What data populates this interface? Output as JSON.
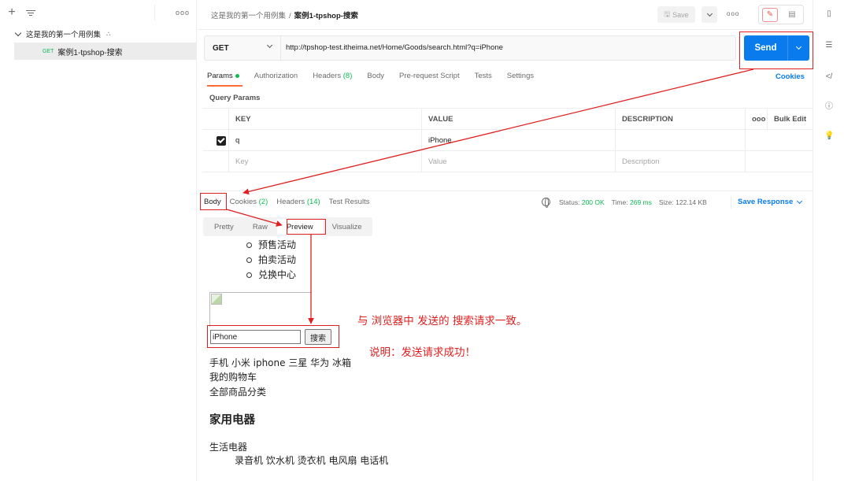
{
  "sidebar": {
    "collection_name": "这是我的第一个用例集",
    "request": {
      "method": "GET",
      "name": "案例1-tpshop-搜索"
    }
  },
  "breadcrumb": {
    "collection": "这是我的第一个用例集",
    "separator": "/",
    "request": "案例1-tpshop-搜索"
  },
  "toolbar": {
    "save_label": "Save"
  },
  "request": {
    "method": "GET",
    "url": "http://tpshop-test.itheima.net/Home/Goods/search.html?q=iPhone",
    "send_label": "Send",
    "tabs": [
      {
        "label": "Params",
        "suffix": ""
      },
      {
        "label": "Authorization",
        "suffix": ""
      },
      {
        "label": "Headers",
        "suffix": "(8)"
      },
      {
        "label": "Body",
        "suffix": ""
      },
      {
        "label": "Pre-request Script",
        "suffix": ""
      },
      {
        "label": "Tests",
        "suffix": ""
      },
      {
        "label": "Settings",
        "suffix": ""
      }
    ],
    "cookies_link": "Cookies"
  },
  "params": {
    "section_label": "Query Params",
    "headers": {
      "key": "KEY",
      "value": "VALUE",
      "description": "DESCRIPTION",
      "bulk_edit": "Bulk Edit"
    },
    "rows": [
      {
        "key": "q",
        "value": "iPhone",
        "description": ""
      }
    ],
    "placeholders": {
      "key": "Key",
      "value": "Value",
      "description": "Description"
    }
  },
  "response": {
    "tabs": [
      {
        "label": "Body",
        "count": ""
      },
      {
        "label": "Cookies",
        "count": "(2)"
      },
      {
        "label": "Headers",
        "count": "(14)"
      },
      {
        "label": "Test Results",
        "count": ""
      }
    ],
    "status_label": "Status:",
    "status_value": "200 OK",
    "time_label": "Time:",
    "time_value": "269 ms",
    "size_label": "Size:",
    "size_value": "122.14 KB",
    "save_response": "Save Response",
    "view_tabs": [
      "Pretty",
      "Raw",
      "Preview",
      "Visualize"
    ]
  },
  "preview": {
    "list_items": [
      "预售活动",
      "拍卖活动",
      "兑换中心"
    ],
    "search_value": "iPhone",
    "search_button": "搜索",
    "hot_words": "手机 小米 iphone 三星 华为 冰箱",
    "cart": "我的购物车",
    "all_categories": "全部商品分类",
    "category_heading": "家用电器",
    "subcategory": "生活电器",
    "subcategory_items": "录音机 饮水机 烫衣机 电风扇 电话机"
  },
  "annotations": {
    "note_consistent": "与 浏览器中 发送的 搜索请求一致。",
    "note_success": "说明：发送请求成功！",
    "color": "#e02020"
  }
}
